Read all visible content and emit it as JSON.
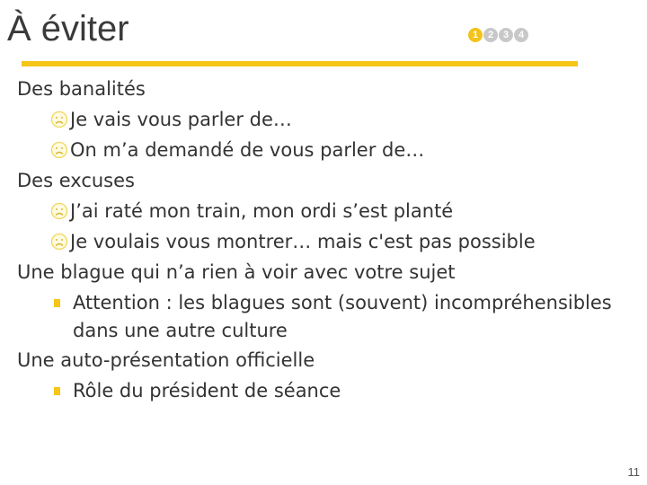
{
  "slide": {
    "title": "À éviter",
    "steps": [
      "1",
      "2",
      "3",
      "4"
    ],
    "active_step": 1,
    "accent_color": "#f5c518",
    "page_number": "11"
  },
  "content": {
    "sections": [
      {
        "heading": "Des banalités",
        "items": [
          {
            "icon": "frown-icon",
            "text": "Je vais vous parler de…"
          },
          {
            "icon": "frown-icon",
            "text": "On m’a demandé de vous parler de…"
          }
        ]
      },
      {
        "heading": "Des excuses",
        "items": [
          {
            "icon": "frown-icon",
            "text": "J’ai raté mon train, mon ordi s’est planté"
          },
          {
            "icon": "frown-icon",
            "text": "Je voulais vous montrer… mais c'est pas possible"
          }
        ]
      },
      {
        "heading": "Une blague qui n’a rien à voir avec votre sujet",
        "items": [
          {
            "icon": "square-bullet",
            "text": "Attention : les blagues sont (souvent) incompréhensibles dans une autre culture"
          }
        ]
      },
      {
        "heading": "Une auto-présentation officielle",
        "items": [
          {
            "icon": "square-bullet",
            "text": "Rôle du président de séance"
          }
        ]
      }
    ]
  }
}
